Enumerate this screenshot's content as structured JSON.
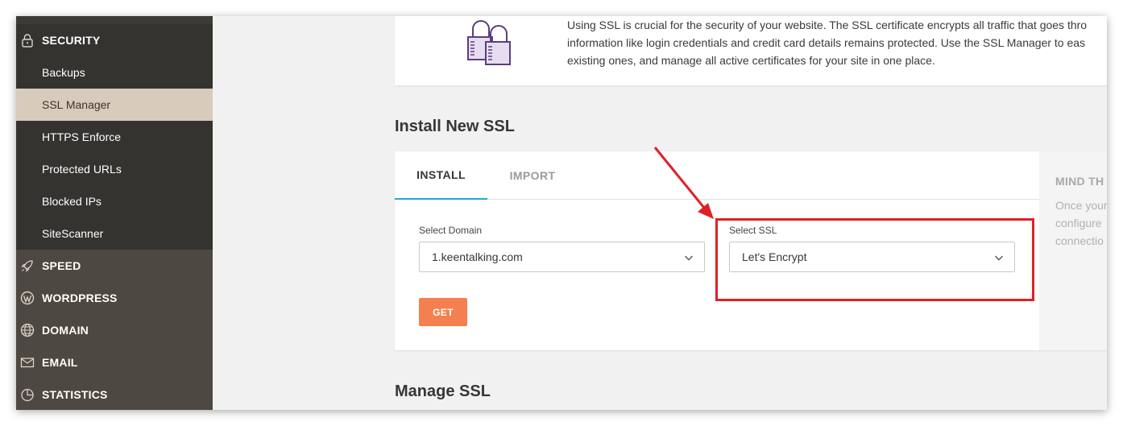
{
  "sidebar": {
    "security": {
      "label": "SECURITY",
      "icon": "lock-icon"
    },
    "security_items": [
      {
        "label": "Backups",
        "active": false
      },
      {
        "label": "SSL Manager",
        "active": true
      },
      {
        "label": "HTTPS Enforce",
        "active": false
      },
      {
        "label": "Protected URLs",
        "active": false
      },
      {
        "label": "Blocked IPs",
        "active": false
      },
      {
        "label": "SiteScanner",
        "active": false
      }
    ],
    "sections": [
      {
        "label": "SPEED",
        "icon": "rocket-icon"
      },
      {
        "label": "WORDPRESS",
        "icon": "wordpress-icon"
      },
      {
        "label": "DOMAIN",
        "icon": "globe-icon"
      },
      {
        "label": "EMAIL",
        "icon": "envelope-icon"
      },
      {
        "label": "STATISTICS",
        "icon": "pie-chart-icon"
      }
    ]
  },
  "intro": {
    "icon": "padlocks-illustration",
    "lines": [
      "Using SSL is crucial for the security of your website. The SSL certificate encrypts all traffic that goes thro",
      "information like login credentials and credit card details remains protected. Use the SSL Manager to eas",
      "existing ones, and manage all active certificates for your site in one place."
    ]
  },
  "install_section": {
    "title": "Install New SSL",
    "tabs": [
      {
        "label": "INSTALL",
        "active": true
      },
      {
        "label": "IMPORT",
        "active": false
      }
    ],
    "domain": {
      "label": "Select Domain",
      "value": "1.keentalking.com"
    },
    "ssl": {
      "label": "Select SSL",
      "value": "Let's Encrypt"
    },
    "get_button": "GET",
    "side_note": {
      "title": "MIND TH",
      "lines": [
        "Once your",
        "configure",
        "connectio"
      ]
    }
  },
  "manage_section": {
    "title": "Manage SSL"
  },
  "annotation": {
    "color": "#dd2126"
  },
  "colors": {
    "sidebar_dark": "#35332f",
    "sidebar": "#4d4841",
    "active_item": "#d8cbbb",
    "accent_tab": "#23a8d7",
    "get_button": "#f5804f"
  }
}
